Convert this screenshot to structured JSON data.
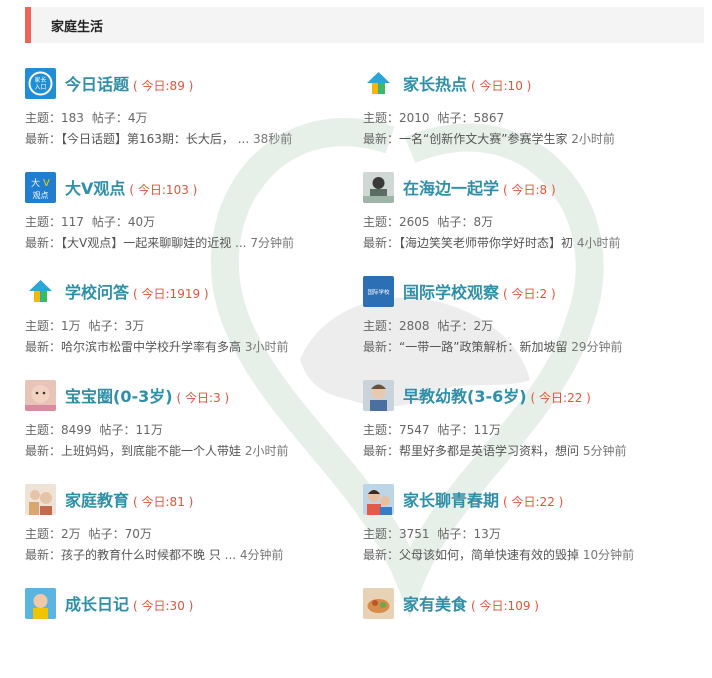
{
  "section": {
    "title": "家庭生活"
  },
  "forums": [
    {
      "name": "今日话题",
      "today": "( 今日:89 )",
      "stats_topics": "主题：183",
      "stats_posts": "帖子：4万",
      "latest_label": "最新：",
      "latest_title": "【今日话题】第163期：长大后，",
      "latest_ellipsis": " ...",
      "latest_time": " 38秒前",
      "icon": "jiazhang-rukou-icon"
    },
    {
      "name": "家长热点",
      "today": "( 今日:10 )",
      "stats_topics": "主题：2010",
      "stats_posts": "帖子：5867",
      "latest_label": "最新：",
      "latest_title": "一名“创新作文大赛”参赛学生家",
      "latest_ellipsis": "",
      "latest_time": " 2小时前",
      "icon": "house-logo-icon"
    },
    {
      "name": "大V观点",
      "today": "( 今日:103 )",
      "stats_topics": "主题：117",
      "stats_posts": "帖子：40万",
      "latest_label": "最新：",
      "latest_title": "【大V观点】一起来聊聊娃的近视",
      "latest_ellipsis": " ...",
      "latest_time": " 7分钟前",
      "icon": "dav-guandian-icon"
    },
    {
      "name": "在海边一起学",
      "today": "( 今日:8 )",
      "stats_topics": "主题：2605",
      "stats_posts": "帖子：8万",
      "latest_label": "最新：",
      "latest_title": "【海边笑笑老师带你学好时态】初",
      "latest_ellipsis": "",
      "latest_time": " 4小时前",
      "icon": "teacher-photo-icon"
    },
    {
      "name": "学校问答",
      "today": "( 今日:1919 )",
      "stats_topics": "主题：1万",
      "stats_posts": "帖子：3万",
      "latest_label": "最新：",
      "latest_title": "哈尔滨市松雷中学校升学率有多高",
      "latest_ellipsis": "",
      "latest_time": " 3小时前",
      "icon": "house-logo-icon"
    },
    {
      "name": "国际学校观察",
      "today": "( 今日:2 )",
      "stats_topics": "主题：2808",
      "stats_posts": "帖子：2万",
      "latest_label": "最新：",
      "latest_title": "“一带一路”政策解析：新加坡留",
      "latest_ellipsis": "",
      "latest_time": " 29分钟前",
      "icon": "guoji-xuexiao-icon"
    },
    {
      "name": "宝宝圈(0-3岁)",
      "today": "( 今日:3 )",
      "stats_topics": "主题：8499",
      "stats_posts": "帖子：11万",
      "latest_label": "最新：",
      "latest_title": "上班妈妈，到底能不能一个人带娃",
      "latest_ellipsis": "",
      "latest_time": " 2小时前",
      "icon": "baby-photo-icon"
    },
    {
      "name": "早教幼教(3-6岁)",
      "today": "( 今日:22 )",
      "stats_topics": "主题：7547",
      "stats_posts": "帖子：11万",
      "latest_label": "最新：",
      "latest_title": "帮里好多都是英语学习资料，想问",
      "latest_ellipsis": "",
      "latest_time": " 5分钟前",
      "icon": "child-photo-icon"
    },
    {
      "name": "家庭教育",
      "today": "( 今日:81 )",
      "stats_topics": "主题：2万",
      "stats_posts": "帖子：70万",
      "latest_label": "最新：",
      "latest_title": "孩子的教育什么时候都不晚 只",
      "latest_ellipsis": " ...",
      "latest_time": " 4分钟前",
      "icon": "family-photo-icon"
    },
    {
      "name": "家长聊青春期",
      "today": "( 今日:22 )",
      "stats_topics": "主题：3751",
      "stats_posts": "帖子：13万",
      "latest_label": "最新：",
      "latest_title": "父母该如何，简单快速有效的毁掉",
      "latest_ellipsis": "",
      "latest_time": " 10分钟前",
      "icon": "teen-photo-icon"
    },
    {
      "name": "成长日记",
      "today": "( 今日:30 )",
      "stats_topics": "",
      "stats_posts": "",
      "latest_label": "",
      "latest_title": "",
      "latest_ellipsis": "",
      "latest_time": "",
      "icon": "kid-photo-icon"
    },
    {
      "name": "家有美食",
      "today": "( 今日:109 )",
      "stats_topics": "",
      "stats_posts": "",
      "latest_label": "",
      "latest_title": "",
      "latest_ellipsis": "",
      "latest_time": "",
      "icon": "food-photo-icon"
    }
  ],
  "colors": {
    "accent": "#f0635a",
    "forum_name": "#2f8fa8",
    "today": "#e3533b"
  }
}
